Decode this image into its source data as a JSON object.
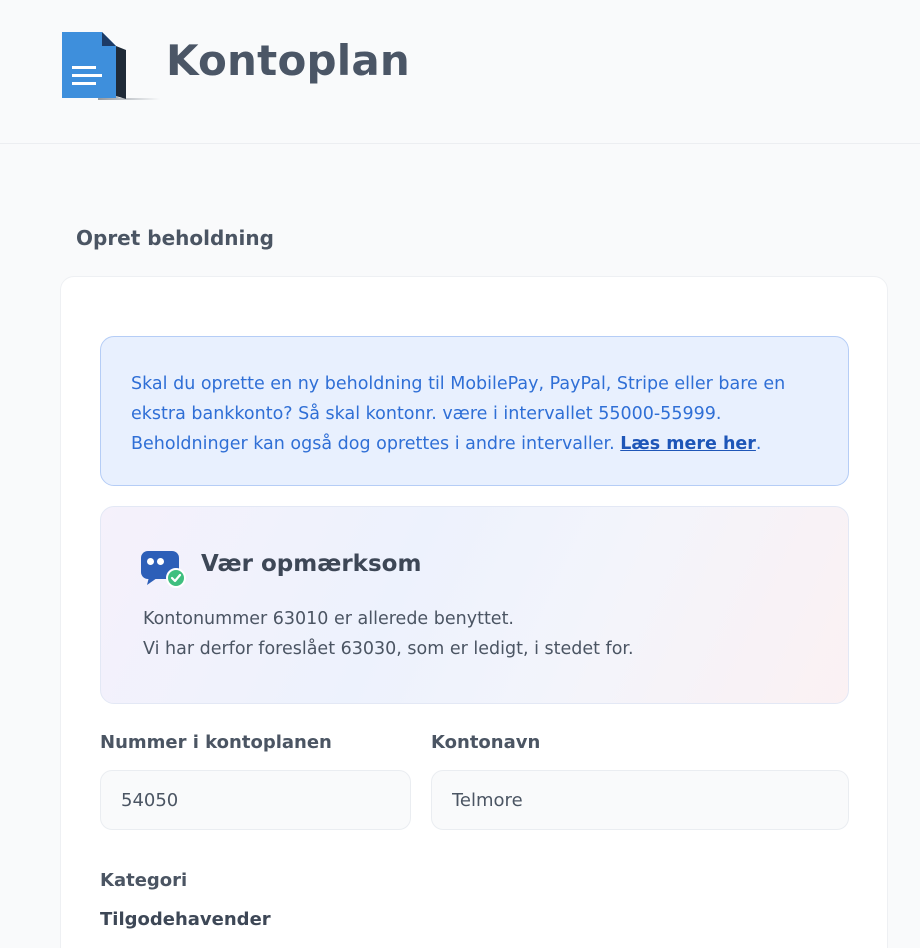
{
  "header": {
    "title": "Kontoplan",
    "logo_icon": "document-icon"
  },
  "section": {
    "title": "Opret beholdning"
  },
  "info": {
    "text": "Skal du oprette en ny beholdning til MobilePay, PayPal, Stripe eller bare en ekstra bankkonto? Så skal kontonr. være i intervallet 55000-55999. Beholdninger kan også dog oprettes i andre intervaller. ",
    "link_label": "Læs mere her",
    "trailing": "."
  },
  "notice": {
    "icon": "chat-check-icon",
    "title": "Vær opmærksom",
    "line1": "Kontonummer 63010 er allerede benyttet.",
    "line2": "Vi har derfor foreslået 63030, som er ledigt, i stedet for."
  },
  "form": {
    "number_label": "Nummer i kontoplanen",
    "number_value": "54050",
    "name_label": "Kontonavn",
    "name_value": "Telmore",
    "category_label": "Kategori",
    "category_value": "Tilgodehavender"
  },
  "colors": {
    "info_text": "#2f6fd6",
    "info_bg": "#e8f0fe",
    "title": "#4b5666"
  }
}
